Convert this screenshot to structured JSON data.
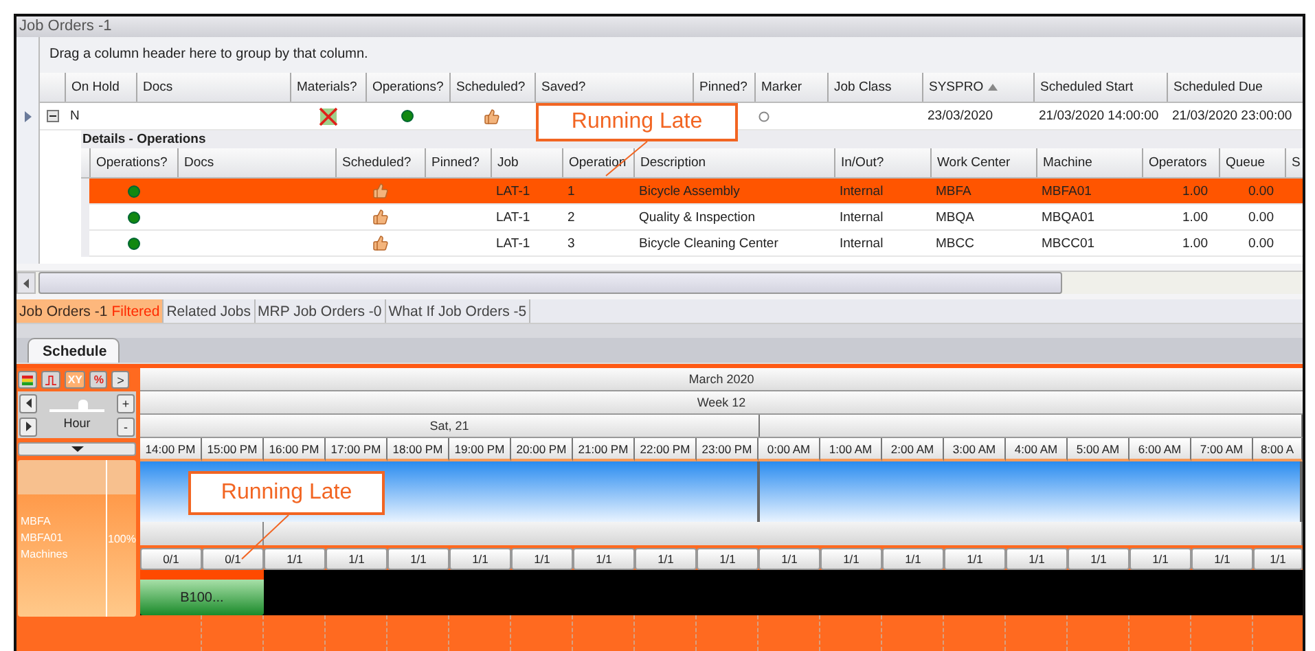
{
  "window": {
    "title": "Job Orders -1"
  },
  "group_panel": {
    "text": "Drag a column header here to group by that column."
  },
  "job_table": {
    "columns": [
      {
        "label": "On Hold",
        "sorted": false
      },
      {
        "label": "Docs",
        "sorted": false
      },
      {
        "label": "Materials?",
        "sorted": false
      },
      {
        "label": "Operations?",
        "sorted": false
      },
      {
        "label": "Scheduled?",
        "sorted": false
      },
      {
        "label": "Saved?",
        "sorted": false
      },
      {
        "label": "Pinned?",
        "sorted": false
      },
      {
        "label": "Marker",
        "sorted": false
      },
      {
        "label": "Job Class",
        "sorted": false
      },
      {
        "label": "SYSPRO",
        "sorted": true
      },
      {
        "label": "Scheduled Start",
        "sorted": false
      },
      {
        "label": "Scheduled Due",
        "sorted": false
      }
    ],
    "rows": [
      {
        "current": true,
        "expanded": true,
        "cells": [
          {
            "kind": "text",
            "text": "N"
          },
          {
            "kind": "blank"
          },
          {
            "kind": "materials",
            "ok": false
          },
          {
            "kind": "status",
            "ok": true
          },
          {
            "kind": "thumb"
          },
          {
            "kind": "blank"
          },
          {
            "kind": "blank"
          },
          {
            "kind": "radio",
            "checked": false
          },
          {
            "kind": "blank"
          },
          {
            "kind": "text",
            "text": "23/03/2020"
          },
          {
            "kind": "text",
            "text": "21/03/2020 14:00:00"
          },
          {
            "kind": "text",
            "text": "21/03/2020 23:00:00"
          }
        ]
      }
    ]
  },
  "details": {
    "title": "Details - Operations",
    "columns": [
      {
        "label": "Operations?"
      },
      {
        "label": "Docs"
      },
      {
        "label": "Scheduled?"
      },
      {
        "label": "Pinned?"
      },
      {
        "label": "Job"
      },
      {
        "label": "Operation"
      },
      {
        "label": "Description"
      },
      {
        "label": "In/Out?"
      },
      {
        "label": "Work Center"
      },
      {
        "label": "Machine"
      },
      {
        "label": "Operators"
      },
      {
        "label": "Queue"
      },
      {
        "label": "S"
      }
    ],
    "rows": [
      {
        "selected": true,
        "cells": [
          {
            "kind": "status",
            "ok": true
          },
          {
            "kind": "blank"
          },
          {
            "kind": "thumb"
          },
          {
            "kind": "blank"
          },
          {
            "kind": "text",
            "text": "LAT-1"
          },
          {
            "kind": "text",
            "text": "1"
          },
          {
            "kind": "text",
            "text": "Bicycle Assembly"
          },
          {
            "kind": "text",
            "text": "Internal"
          },
          {
            "kind": "text",
            "text": "MBFA"
          },
          {
            "kind": "text",
            "text": "MBFA01"
          },
          {
            "kind": "number",
            "text": "1.00"
          },
          {
            "kind": "number",
            "text": "0.00"
          },
          {
            "kind": "blank"
          }
        ]
      },
      {
        "selected": false,
        "cells": [
          {
            "kind": "status",
            "ok": true
          },
          {
            "kind": "blank"
          },
          {
            "kind": "thumb"
          },
          {
            "kind": "blank"
          },
          {
            "kind": "text",
            "text": "LAT-1"
          },
          {
            "kind": "text",
            "text": "2"
          },
          {
            "kind": "text",
            "text": "Quality & Inspection"
          },
          {
            "kind": "text",
            "text": "Internal"
          },
          {
            "kind": "text",
            "text": "MBQA"
          },
          {
            "kind": "text",
            "text": "MBQA01"
          },
          {
            "kind": "number",
            "text": "1.00"
          },
          {
            "kind": "number",
            "text": "0.00"
          },
          {
            "kind": "blank"
          }
        ]
      },
      {
        "selected": false,
        "cells": [
          {
            "kind": "status",
            "ok": true
          },
          {
            "kind": "blank"
          },
          {
            "kind": "thumb"
          },
          {
            "kind": "blank"
          },
          {
            "kind": "text",
            "text": "LAT-1"
          },
          {
            "kind": "text",
            "text": "3"
          },
          {
            "kind": "text",
            "text": "Bicycle Cleaning Center"
          },
          {
            "kind": "text",
            "text": "Internal"
          },
          {
            "kind": "text",
            "text": "MBCC"
          },
          {
            "kind": "text",
            "text": "MBCC01"
          },
          {
            "kind": "number",
            "text": "1.00"
          },
          {
            "kind": "number",
            "text": "0.00"
          },
          {
            "kind": "blank"
          }
        ]
      }
    ]
  },
  "view_tabs": [
    {
      "label": "Job Orders -1",
      "badge": "Filtered",
      "selected": true
    },
    {
      "label": "Related Jobs",
      "selected": false
    },
    {
      "label": "MRP Job Orders -0",
      "selected": false
    },
    {
      "label": "What If Job Orders -5",
      "selected": false
    }
  ],
  "schedule_tabs": [
    {
      "label": "Schedule",
      "selected": true
    }
  ],
  "schedule": {
    "toolbar": [
      {
        "kind": "legend",
        "on": false
      },
      {
        "kind": "step",
        "on": false
      },
      {
        "kind": "text",
        "label": "XY",
        "on": true
      },
      {
        "kind": "text",
        "label": "%",
        "on": false
      }
    ],
    "expand_label": ">",
    "zoom": {
      "unit": "Hour",
      "level": 0.6,
      "zoom_in": "+",
      "zoom_out": "-"
    },
    "month": "March 2020",
    "week": "Week 12",
    "days": [
      {
        "label": "Sat, 21"
      }
    ],
    "hours": [
      "14:00 PM",
      "15:00 PM",
      "16:00 PM",
      "17:00 PM",
      "18:00 PM",
      "19:00 PM",
      "20:00 PM",
      "21:00 PM",
      "22:00 PM",
      "23:00 PM",
      "0:00 AM",
      "1:00 AM",
      "2:00 AM",
      "3:00 AM",
      "4:00 AM",
      "5:00 AM",
      "6:00 AM",
      "7:00 AM",
      "8:00 A"
    ],
    "resource": {
      "lines": [
        "MBFA",
        "MBFA01",
        "Machines"
      ],
      "utilization": "100%"
    },
    "counts": [
      "0/1",
      "0/1",
      "1/1",
      "1/1",
      "1/1",
      "1/1",
      "1/1",
      "1/1",
      "1/1",
      "1/1",
      "1/1",
      "1/1",
      "1/1",
      "1/1",
      "1/1",
      "1/1",
      "1/1",
      "1/1",
      "1/1"
    ],
    "bars": [
      {
        "label": "B100...",
        "late": true
      }
    ]
  },
  "callouts": [
    {
      "text": "Running Late"
    },
    {
      "text": "Running Late"
    }
  ]
}
